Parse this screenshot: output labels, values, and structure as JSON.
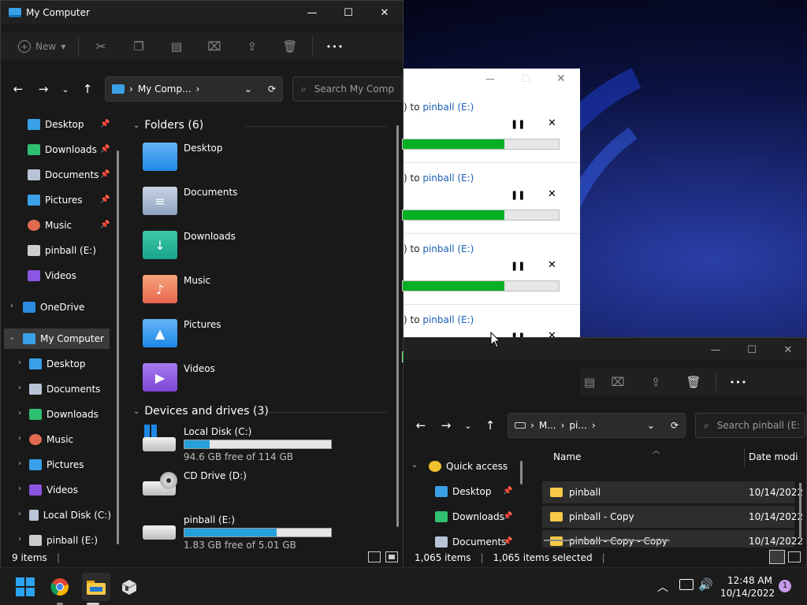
{
  "win1": {
    "title": "My Computer",
    "toolbar": {
      "new_label": "New",
      "more": "•••"
    },
    "address": {
      "crumb": "My Comp...",
      "search_placeholder": "Search My Comp"
    },
    "nav": [
      {
        "label": "Desktop",
        "pinned": true
      },
      {
        "label": "Downloads",
        "pinned": true
      },
      {
        "label": "Documents",
        "pinned": true
      },
      {
        "label": "Pictures",
        "pinned": true
      },
      {
        "label": "Music",
        "pinned": true
      },
      {
        "label": "pinball (E:)",
        "pinned": false
      },
      {
        "label": "Videos",
        "pinned": false
      },
      {
        "label": "OneDrive",
        "pinned": false
      },
      {
        "label": "My Computer",
        "pinned": false
      },
      {
        "label": "Desktop",
        "pinned": false
      },
      {
        "label": "Documents",
        "pinned": false
      },
      {
        "label": "Downloads",
        "pinned": false
      },
      {
        "label": "Music",
        "pinned": false
      },
      {
        "label": "Pictures",
        "pinned": false
      },
      {
        "label": "Videos",
        "pinned": false
      },
      {
        "label": "Local Disk (C:)",
        "pinned": false
      },
      {
        "label": "pinball (E:)",
        "pinned": false
      }
    ],
    "folders_header": "Folders (6)",
    "folders": [
      "Desktop",
      "Documents",
      "Downloads",
      "Music",
      "Pictures",
      "Videos"
    ],
    "drives_header": "Devices and drives (3)",
    "drives": [
      {
        "name": "Local Disk (C:)",
        "free": "94.6 GB free of 114 GB",
        "used_fraction": 0.17
      },
      {
        "name": "CD Drive (D:)",
        "free": "",
        "used_fraction": null
      },
      {
        "name": "pinball (E:)",
        "free": "1.83 GB free of 5.01 GB",
        "used_fraction": 0.63
      }
    ],
    "status": "9 items"
  },
  "copy_dialog": {
    "rows": [
      {
        "prefix": ") to ",
        "dest": "pinball (E:)",
        "progress": 0.65
      },
      {
        "prefix": ") to ",
        "dest": "pinball (E:)",
        "progress": 0.65
      },
      {
        "prefix": ") to ",
        "dest": "pinball (E:)",
        "progress": 0.65
      },
      {
        "prefix": ") to ",
        "dest": "pinball (E:)",
        "progress": 0.05
      }
    ]
  },
  "win2": {
    "address": {
      "crumb1": "M...",
      "crumb2": "pi...",
      "search_placeholder": "Search pinball (E:"
    },
    "nav": [
      {
        "label": "Quick access"
      },
      {
        "label": "Desktop"
      },
      {
        "label": "Downloads"
      },
      {
        "label": "Documents"
      }
    ],
    "columns": {
      "name": "Name",
      "date": "Date modi"
    },
    "rows": [
      {
        "name": "pinball",
        "date": "10/14/2022"
      },
      {
        "name": "pinball - Copy",
        "date": "10/14/2022"
      },
      {
        "name": "pinball - Copy - Copy",
        "date": "10/14/2022"
      }
    ],
    "status_items": "1,065 items",
    "status_selected": "1,065 items selected"
  },
  "taskbar": {
    "time": "12:48 AM",
    "date": "10/14/2022",
    "notif_count": "1"
  }
}
